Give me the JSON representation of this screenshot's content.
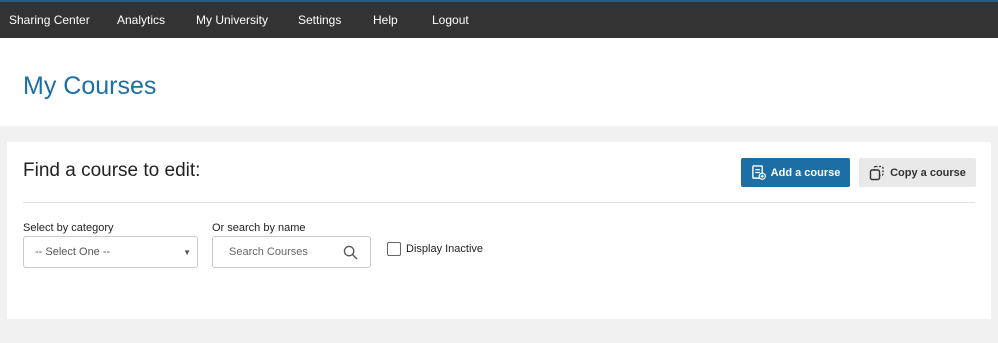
{
  "nav": {
    "items": [
      {
        "label": "Sharing Center"
      },
      {
        "label": "Analytics"
      },
      {
        "label": "My University"
      },
      {
        "label": "Settings"
      },
      {
        "label": "Help"
      },
      {
        "label": "Logout"
      }
    ]
  },
  "header": {
    "title": "My Courses"
  },
  "panel": {
    "title": "Find a course to edit:",
    "add_button_label": "Add a course",
    "copy_button_label": "Copy a course",
    "category_label": "Select by category",
    "category_selected": "-- Select One --",
    "search_label": "Or search by name",
    "search_placeholder": "Search Courses",
    "search_value": "",
    "display_inactive_label": "Display Inactive",
    "display_inactive_checked": false
  },
  "colors": {
    "nav_bg": "#333333",
    "accent": "#1c6ea4",
    "page_bg": "#f1f1f1"
  }
}
